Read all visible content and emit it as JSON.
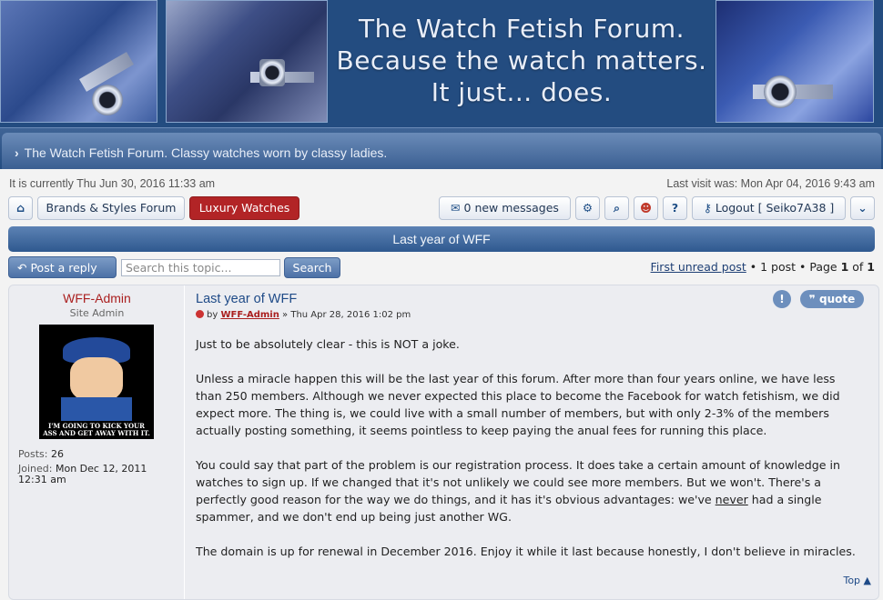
{
  "banner": {
    "line1": "The Watch Fetish Forum.",
    "line2": "Because the watch matters.",
    "line3": "It just... does."
  },
  "nav": {
    "title": "The Watch Fetish Forum. Classy watches worn by classy ladies."
  },
  "info": {
    "current_time": "It is currently Thu Jun 30, 2016 11:33 am",
    "last_visit": "Last visit was: Mon Apr 04, 2016 9:43 am"
  },
  "toolbar": {
    "brands_label": "Brands & Styles Forum",
    "luxury_label": "Luxury Watches",
    "messages_label": "0 new messages",
    "logout_label": "Logout [ Seiko7A38 ]"
  },
  "topic": {
    "title": "Last year of WFF"
  },
  "actions": {
    "reply_label": "Post a reply",
    "search_placeholder": "Search this topic...",
    "search_button": "Search",
    "first_unread": "First unread post",
    "post_count": " • 1 post • Page ",
    "page_current": "1",
    "page_of": " of ",
    "page_total": "1"
  },
  "post": {
    "author": "WFF-Admin",
    "rank": "Site Admin",
    "avatar_caption": "I'M GOING TO KICK YOUR ASS AND GET AWAY WITH IT.",
    "posts_label": "Posts:",
    "posts_value": "26",
    "joined_label": "Joined:",
    "joined_value": "Mon Dec 12, 2011",
    "joined_time": "12:31 am",
    "subject": "Last year of WFF",
    "meta_by": "by",
    "meta_author": "WFF-Admin",
    "meta_date": "» Thu Apr 28, 2016 1:02 pm",
    "quote_label": "quote",
    "report_label": "!",
    "p1": "Just to be absolutely clear - this is NOT a joke.",
    "p2": "Unless a miracle happen this will be the last year of this forum. After more than four years online, we have less than 250 members. Although we never expected this place to become the Facebook for watch fetishism, we did expect more. The thing is, we could live with a small number of members, but with only 2-3% of the members actually posting something, it seems pointless to keep paying the anual fees for running this place.",
    "p3_a": "You could say that part of the problem is our registration process. It does take a certain amount of knowledge in watches to sign up. If we changed that it's not unlikely we could see more members. But we won't. There's a perfectly good reason for the way we do things, and it has it's obvious advantages: we've ",
    "p3_never": "never",
    "p3_b": " had a single spammer, and we don't end up being just another WG.",
    "p4": "The domain is up for renewal in December 2016. Enjoy it while it last because honestly, I don't believe in miracles.",
    "top_label": "Top"
  },
  "icons": {
    "home": "home-icon",
    "envelope": "envelope-icon",
    "gear": "gear-icon",
    "search": "search-icon",
    "members": "members-icon",
    "help": "help-icon",
    "key": "key-icon",
    "chevron": "chevron-down-icon",
    "reply": "reply-arrow-icon"
  },
  "colors": {
    "header_blue": "#234c80",
    "accent_red": "#b22426",
    "link_blue": "#1e4a87"
  }
}
